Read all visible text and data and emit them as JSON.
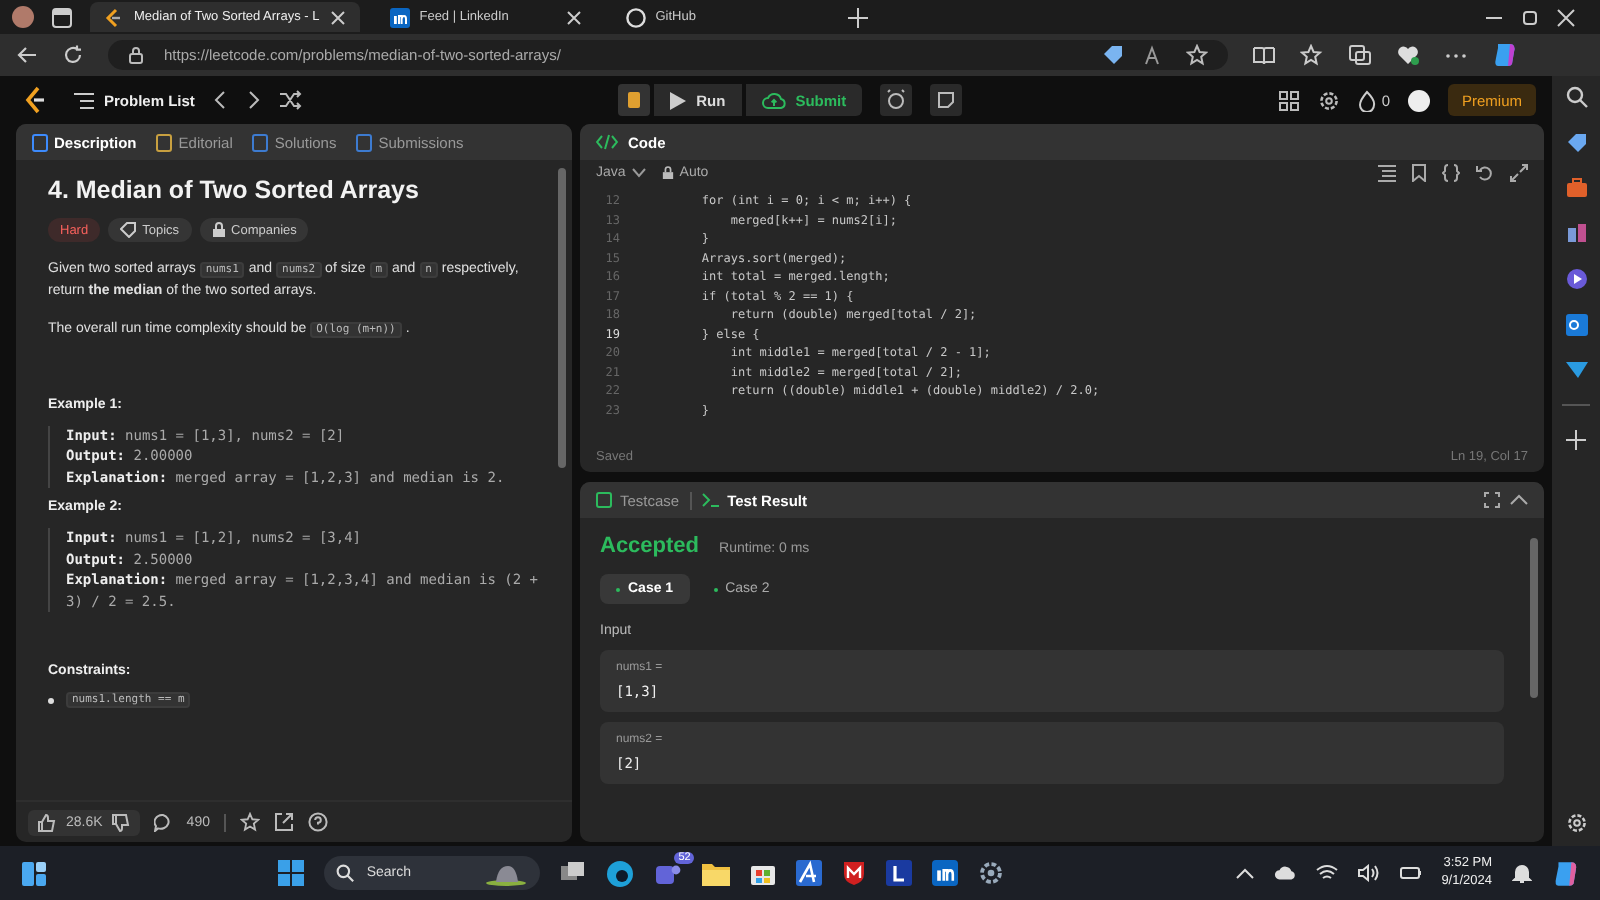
{
  "browser": {
    "tabs": [
      {
        "title": "Median of Two Sorted Arrays - L",
        "selected": true
      },
      {
        "title": "Feed | LinkedIn",
        "selected": false
      },
      {
        "title": "GitHub",
        "selected": false
      }
    ],
    "address": "https://leetcode.com/problems/median-of-two-sorted-arrays/"
  },
  "nav": {
    "problem_list": "Problem List",
    "run": "Run",
    "submit": "Submit",
    "streak": "0",
    "premium": "Premium"
  },
  "description": {
    "tabs": [
      {
        "label": "Description",
        "selected": true
      },
      {
        "label": "Editorial",
        "selected": false
      },
      {
        "label": "Solutions",
        "selected": false
      },
      {
        "label": "Submissions",
        "selected": false
      }
    ],
    "title": "4. Median of Two Sorted Arrays",
    "tags": [
      {
        "label": "Hard",
        "kind": "difficulty"
      },
      {
        "label": "Topics",
        "kind": "tag"
      },
      {
        "label": "Companies",
        "kind": "lock"
      }
    ],
    "paragraphs": [
      [
        {
          "kind": "text",
          "text": "Given two sorted arrays"
        },
        {
          "kind": "code",
          "text": "nums1"
        },
        {
          "kind": "text",
          "text": "and"
        },
        {
          "kind": "code",
          "text": "nums2"
        },
        {
          "kind": "text",
          "text": "of size"
        },
        {
          "kind": "code",
          "text": "m"
        },
        {
          "kind": "text",
          "text": "and"
        },
        {
          "kind": "code",
          "text": "n"
        },
        {
          "kind": "text",
          "text": "respectively, return **the median** of the two sorted arrays."
        }
      ],
      [
        {
          "kind": "text",
          "text": "The overall run time complexity should be"
        },
        {
          "kind": "code",
          "text": "O(log (m+n))"
        },
        {
          "kind": "text",
          "text": "."
        }
      ]
    ],
    "examples": [
      {
        "title": "Example 1:",
        "lines": [
          {
            "label": "Input:",
            "text": "nums1 = [1,3], nums2 = [2]"
          },
          {
            "label": "Output:",
            "text": "2.00000"
          },
          {
            "label": "Explanation:",
            "text": "merged array = [1,2,3] and median is 2."
          }
        ]
      },
      {
        "title": "Example 2:",
        "lines": [
          {
            "label": "Input:",
            "text": "nums1 = [1,2], nums2 = [3,4]"
          },
          {
            "label": "Output:",
            "text": "2.50000"
          },
          {
            "label": "Explanation:",
            "text": "merged array = [1,2,3,4] and median is (2 + 3) / 2 = 2.5."
          }
        ]
      }
    ],
    "constraints_title": "Constraints:",
    "constraints": [
      "nums1.length == m"
    ],
    "likes": "28.6K",
    "comments": "490"
  },
  "code": {
    "title": "Code",
    "language": "Java",
    "mode": "Auto",
    "lines": [
      {
        "number": "12",
        "current": false,
        "text": "        for (int i = 0; i < m; i++) {"
      },
      {
        "number": "13",
        "current": false,
        "text": "            merged[k++] = nums2[i];"
      },
      {
        "number": "14",
        "current": false,
        "text": "        }"
      },
      {
        "number": "15",
        "current": false,
        "text": "        Arrays.sort(merged);"
      },
      {
        "number": "16",
        "current": false,
        "text": "        int total = merged.length;"
      },
      {
        "number": "17",
        "current": false,
        "text": "        if (total % 2 == 1) {"
      },
      {
        "number": "18",
        "current": false,
        "text": "            return (double) merged[total / 2];"
      },
      {
        "number": "19",
        "current": true,
        "text": "        } else {"
      },
      {
        "number": "20",
        "current": false,
        "text": "            int middle1 = merged[total / 2 - 1];"
      },
      {
        "number": "21",
        "current": false,
        "text": "            int middle2 = merged[total / 2];"
      },
      {
        "number": "22",
        "current": false,
        "text": "            return ((double) middle1 + (double) middle2) / 2.0;"
      },
      {
        "number": "23",
        "current": false,
        "text": "        }"
      }
    ],
    "saved": "Saved",
    "cursor": "Ln 19, Col 17"
  },
  "result": {
    "tabs": [
      {
        "label": "Testcase",
        "selected": false
      },
      {
        "label": "Test Result",
        "selected": true
      }
    ],
    "status": "Accepted",
    "runtime": "Runtime: 0 ms",
    "cases": [
      {
        "label": "Case 1",
        "selected": true
      },
      {
        "label": "Case 2",
        "selected": false
      }
    ],
    "input_label": "Input",
    "inputs": [
      {
        "name": "nums1 =",
        "value": "[1,3]"
      },
      {
        "name": "nums2 =",
        "value": "[2]"
      }
    ]
  },
  "taskbar": {
    "search": "Search",
    "teams_badge": "52",
    "time": "3:52 PM",
    "date": "9/1/2024"
  }
}
